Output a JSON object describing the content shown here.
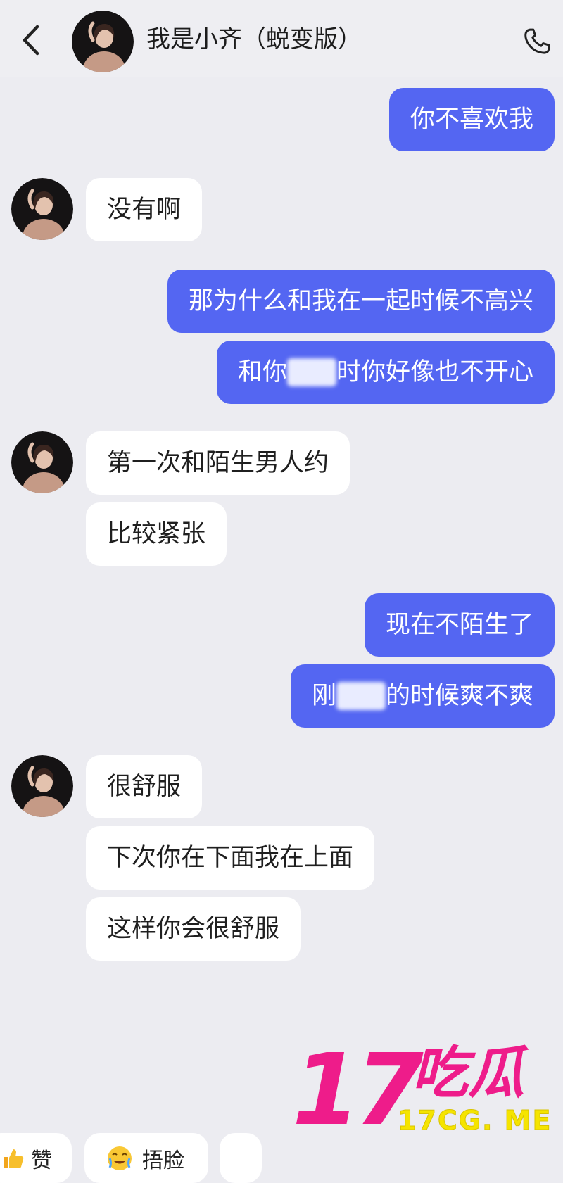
{
  "header": {
    "title": "我是小齐（蜕变版）",
    "back_icon": "chevron-left-icon",
    "call_icon": "phone-icon"
  },
  "messages": [
    {
      "side": "out",
      "text": "你不喜欢我"
    },
    {
      "side": "in",
      "text": "没有啊"
    },
    {
      "side": "out",
      "text": "那为什么和我在一起时候不高兴"
    },
    {
      "side": "out",
      "pre": "和你",
      "masked": "做爱",
      "post": "时你好像也不开心"
    },
    {
      "side": "in",
      "text": "第一次和陌生男人约"
    },
    {
      "side": "in",
      "text": "比较紧张"
    },
    {
      "side": "out",
      "text": "现在不陌生了"
    },
    {
      "side": "out",
      "pre": "刚",
      "masked": "操你",
      "post": "的时候爽不爽"
    },
    {
      "side": "in",
      "text": "很舒服"
    },
    {
      "side": "in",
      "text": "下次你在下面我在上面"
    },
    {
      "side": "in",
      "text": "这样你会很舒服"
    }
  ],
  "reactions": [
    {
      "icon": "thumbs-up-icon",
      "label": "赞"
    },
    {
      "icon": "facepalm-emoji-icon",
      "label": "捂脸"
    }
  ],
  "watermark": {
    "number": "17",
    "brand": "吃瓜",
    "url": "17CG. ME"
  },
  "colors": {
    "outgoing_bubble": "#5466f2",
    "incoming_bubble": "#ffffff",
    "background": "#ececf1",
    "watermark_pink": "#ee1c8a",
    "watermark_yellow": "#f5e400"
  }
}
